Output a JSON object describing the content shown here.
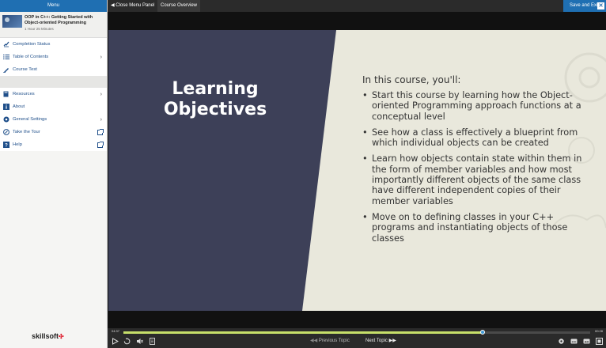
{
  "menu": {
    "header": "Menu",
    "course": {
      "title": "OOP in C++: Getting Started with Object-oriented Programming",
      "duration": "1 Hour 25 Minutes"
    },
    "items_group1": [
      {
        "label": "Completion Status",
        "icon": "completion-status-icon"
      },
      {
        "label": "Table of Contents",
        "icon": "table-of-contents-icon"
      },
      {
        "label": "Course Test",
        "icon": "course-test-icon"
      }
    ],
    "items_group2": [
      {
        "label": "Resources",
        "icon": "resources-icon"
      },
      {
        "label": "About",
        "icon": "info-icon"
      },
      {
        "label": "General Settings",
        "icon": "settings-icon"
      },
      {
        "label": "Take the Tour",
        "icon": "tour-icon"
      },
      {
        "label": "Help",
        "icon": "help-icon"
      }
    ],
    "brand": "skillsoft"
  },
  "topbar": {
    "close_panel": "Close Menu Panel",
    "tab": "Course Overview",
    "save_exit": "Save and Exit",
    "close_glyph": "✕"
  },
  "slide": {
    "title_line1": "Learning",
    "title_line2": "Objectives",
    "intro": "In this course, you'll:",
    "bullets": [
      "Start this course by learning how the Object-oriented Programming approach functions at a conceptual level",
      "See how a class is effectively a blueprint from which individual objects can be created",
      "Learn how objects contain state within them in the form of member variables and how most importantly different objects of the same class have different independent copies of their member variables",
      "Move on to defining classes in your C++ programs and instantiating objects of those classes"
    ]
  },
  "player": {
    "elapsed": "04:37",
    "total": "00:28",
    "progress": 0.77,
    "previous": "Previous Topic",
    "next": "Next Topic"
  },
  "colors": {
    "accent": "#1f6fb2",
    "slide_dark": "#3d4058",
    "slide_light": "#e9e8dc",
    "progress": "#c6df6a"
  }
}
